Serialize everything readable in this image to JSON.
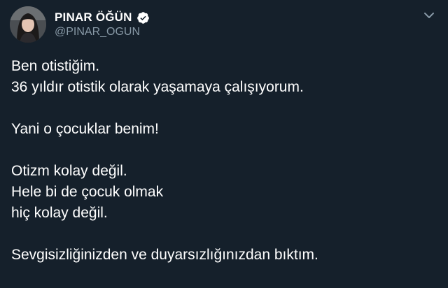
{
  "tweet": {
    "author": {
      "display_name": "PINAR ÖĞÜN",
      "handle": "@PINAR_OGUN",
      "verified": true,
      "avatar_icon": "profile-photo"
    },
    "menu_icon": "chevron-down-icon",
    "lines": [
      "Ben otistiğim.",
      "36 yıldır otistik olarak yaşamaya çalışıyorum.",
      "",
      "Yani o çocuklar benim!",
      "",
      "Otizm kolay değil.",
      "Hele bi de çocuk olmak",
      "hiç kolay değil.",
      "",
      "Sevgisizliğinizden ve duyarsızlığınızdan bıktım."
    ]
  },
  "colors": {
    "background": "#15202b",
    "text": "#ffffff",
    "secondary_text": "#8899a6",
    "verified_badge": "#ffffff"
  }
}
